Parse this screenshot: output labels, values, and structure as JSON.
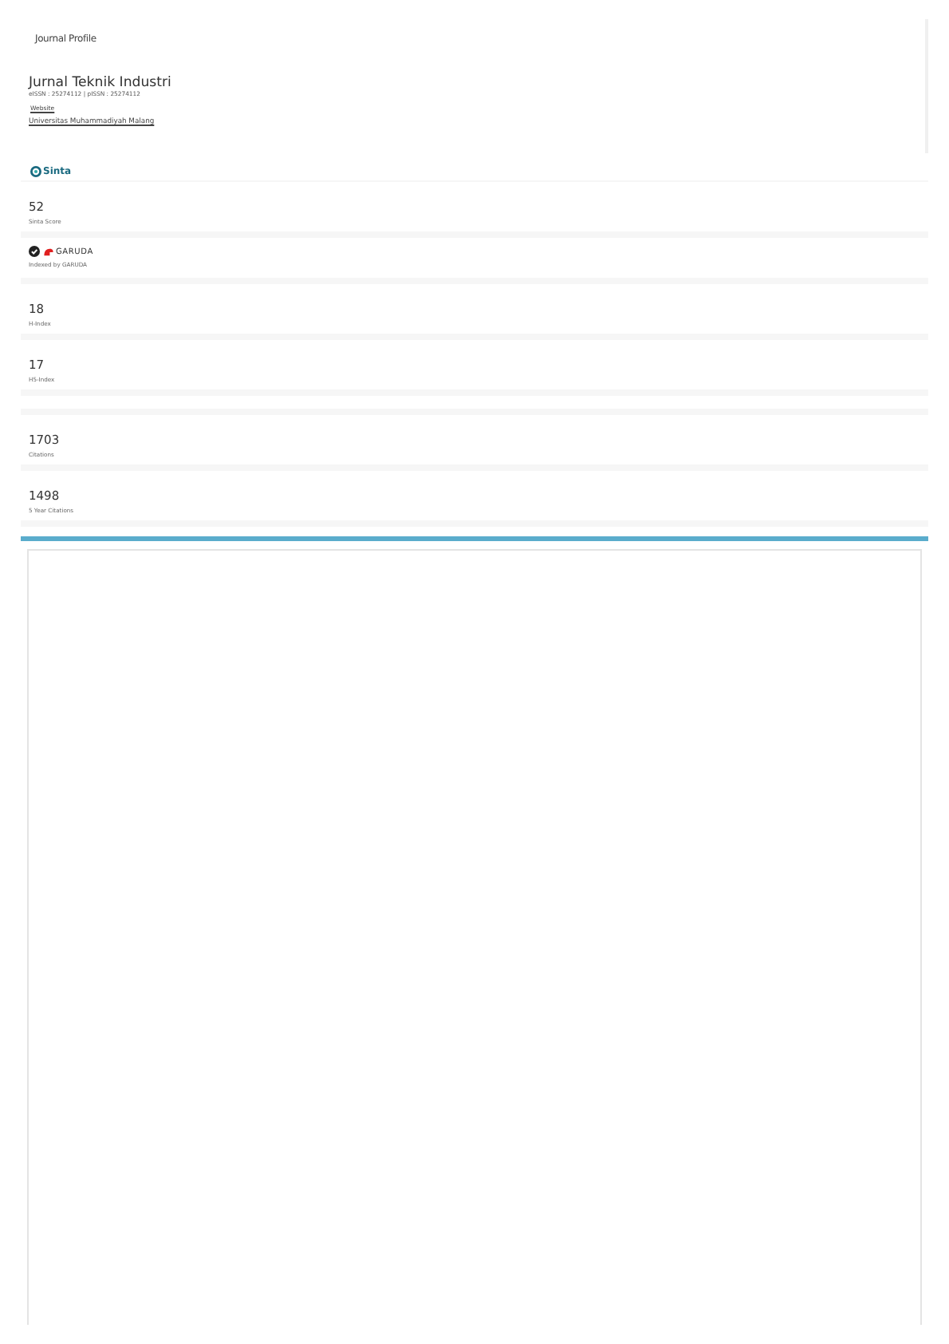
{
  "header": {
    "title": "Journal Profile"
  },
  "journal": {
    "name": "Jurnal Teknik Industri",
    "issn": "eISSN : 25274112 | pISSN : 25274112",
    "link": "Website",
    "affiliation": "Universitas Muhammadiyah Malang"
  },
  "sinta_logo": "Sinta",
  "stats": [
    {
      "kind": "number",
      "value": "52",
      "label": "Sinta Score"
    },
    {
      "kind": "indexed",
      "verified": true,
      "logo": "GARUDA",
      "label": "Indexed by GARUDA"
    },
    {
      "kind": "number",
      "value": "18",
      "label": "H-Index"
    },
    {
      "kind": "number",
      "value": "17",
      "label": "H5-Index"
    },
    {
      "kind": "blank"
    },
    {
      "kind": "number",
      "value": "1703",
      "label": "Citations"
    },
    {
      "kind": "number",
      "value": "1498",
      "label": "5 Year Citations"
    }
  ]
}
